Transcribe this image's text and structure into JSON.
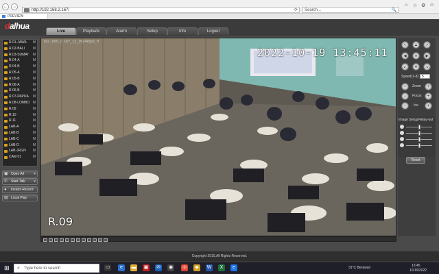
{
  "browser": {
    "address_url": "http://192.168.2.167/",
    "search_placeholder": "Search...",
    "tab_title": "PREVIEW",
    "nav_back_glyph": "←",
    "nav_forward_glyph": "→",
    "home_glyph": "⌂",
    "star_glyph": "☆",
    "gear_glyph": "⚙",
    "smile_glyph": "☺",
    "search_glyph": "🔍"
  },
  "app": {
    "logo": "alhua",
    "logo_prefix": "d",
    "menu": [
      "Live",
      "Playback",
      "Alarm",
      "Setup",
      "Info",
      "Logout"
    ],
    "active_menu": "Live"
  },
  "cameras": [
    {
      "label": "R.01-JAWA",
      "m": "M"
    },
    {
      "label": "R.02-BALI",
      "m": "M"
    },
    {
      "label": "R.03-SUMAT",
      "m": "M"
    },
    {
      "label": "R.04-A",
      "m": "M"
    },
    {
      "label": "R.04-B",
      "m": "M"
    },
    {
      "label": "R.05-A",
      "m": "M"
    },
    {
      "label": "R.05-B",
      "m": "M"
    },
    {
      "label": "R.06-A",
      "m": "M"
    },
    {
      "label": "R.06-B",
      "m": "M"
    },
    {
      "label": "R.07-PAPUA",
      "m": "M"
    },
    {
      "label": "R.08-LOMBO",
      "m": "M"
    },
    {
      "label": "R.09",
      "m": "M"
    },
    {
      "label": "R.10",
      "m": "M"
    },
    {
      "label": "R.11",
      "m": "M"
    },
    {
      "label": "LAB-A",
      "m": "M"
    },
    {
      "label": "LAB-B",
      "m": "M"
    },
    {
      "label": "LAB-C",
      "m": "M"
    },
    {
      "label": "LAB-D",
      "m": "M"
    },
    {
      "label": "LAB-JRGN",
      "m": "M"
    },
    {
      "label": "CAM 01",
      "m": "M"
    }
  ],
  "controls": {
    "open_all": "Open All",
    "start_talk": "Start Talk",
    "instant_record": "Instant Record",
    "local_play": "Local Play"
  },
  "video": {
    "stream_title": "192.168.2.167_12_1024kbps_H",
    "osd_timestamp": "2022-10-19 13:45:11",
    "osd_camera_name": "R.09"
  },
  "ptz": {
    "speed_label": "Speed(1-8)",
    "speed_value": "5",
    "zoom_label": "Zoom",
    "focus_label": "Focus",
    "iris_label": "Iris",
    "arrows": [
      "↖",
      "▲",
      "↗",
      "◀",
      "●",
      "▶",
      "↙",
      "▼",
      "↘"
    ]
  },
  "image_setup": {
    "image_setup_label": "Image Setup",
    "relay_out_label": "Relay-out",
    "slider_levels": [
      0.5,
      0.5,
      0.5,
      0.5
    ],
    "reset_label": "Reset"
  },
  "footer": {
    "copyright": "Copyright 2015,All Rights Reserved."
  },
  "taskbar": {
    "search_placeholder": "Type here to search",
    "weather": "31°C  Berawan",
    "time": "13:45",
    "date": "10/19/2022"
  },
  "colors": {
    "accent": "#d9a020",
    "brand_red": "#e03030",
    "header_bg": "#3b3b3b"
  }
}
